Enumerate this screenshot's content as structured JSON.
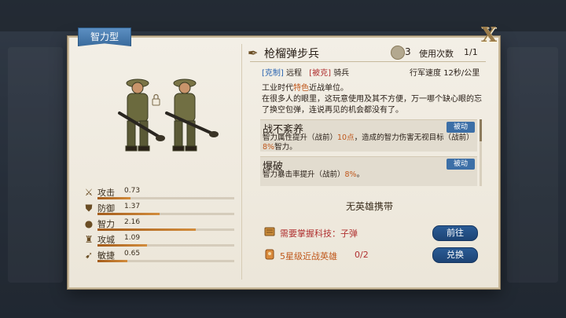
{
  "dialog": {
    "type_tab": "智力型",
    "close_icon": "X"
  },
  "unit": {
    "name": "枪榴弹步兵",
    "cost": "3",
    "uses_label": "使用次数",
    "uses_value": "1/1",
    "counter_tag": "[克制]",
    "counter_value": "远程",
    "countered_tag": "[被克]",
    "countered_value": "骑兵",
    "speed_label": "行军速度",
    "speed_value": "12秒/公里",
    "desc_line1_a": "工业时代",
    "desc_line1_hl": "特色",
    "desc_line1_b": "近战单位。",
    "desc_line2": "在很多人的眼里，这玩意使用及其不方便，万一哪个缺心眼的忘了换空包弹，连说再见的机会都没有了。"
  },
  "skills": [
    {
      "name": "战不紊养",
      "badge": "被动",
      "desc_a": "智力属性提升（战前）",
      "desc_hl1": "10点",
      "desc_b": "，造成的智力伤害无视目标（战前）",
      "desc_hl2": "8%",
      "desc_c": "智力。"
    },
    {
      "name": "爆破",
      "badge": "被动",
      "desc_a": "智力暴击率提升（战前）",
      "desc_hl1": "8%",
      "desc_b": "。",
      "desc_hl2": "",
      "desc_c": ""
    }
  ],
  "stats": [
    {
      "label": "攻击",
      "value": "0.73",
      "fill": 0.73,
      "icon": "sword-icon"
    },
    {
      "label": "防御",
      "value": "1.37",
      "fill": 1.37,
      "icon": "shield-icon"
    },
    {
      "label": "智力",
      "value": "2.16",
      "fill": 2.16,
      "icon": "brain-icon"
    },
    {
      "label": "攻城",
      "value": "1.09",
      "fill": 1.09,
      "icon": "tower-icon"
    },
    {
      "label": "敏捷",
      "value": "0.65",
      "fill": 0.65,
      "icon": "boot-icon"
    }
  ],
  "stat_max": 3.0,
  "hero": {
    "none_text": "无英雄携带"
  },
  "requirements": [
    {
      "text": "需要掌握科技：子弹",
      "button": "前往",
      "icon": "scroll-icon"
    },
    {
      "text": "5星级近战英雄",
      "progress": "0/2",
      "button": "兑换",
      "icon": "card-icon"
    }
  ],
  "colors": {
    "accent_blue": "#3c6fa7",
    "highlight_orange": "#c0581c",
    "warning_red": "#b03030",
    "stat_fill": "#c0782c"
  }
}
